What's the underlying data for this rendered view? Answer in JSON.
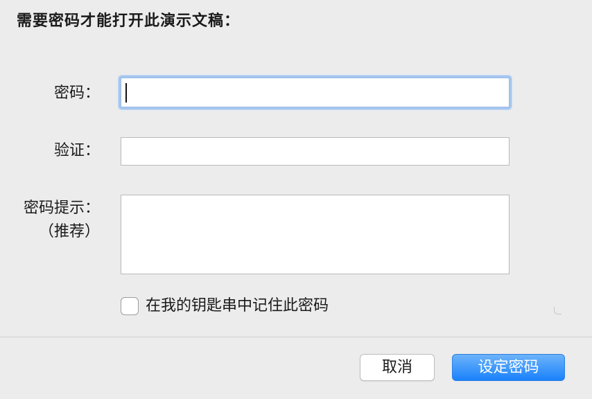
{
  "dialog": {
    "title": "需要密码才能打开此演示文稿："
  },
  "form": {
    "password_label": "密码：",
    "password_value": "",
    "verify_label": "验证：",
    "verify_value": "",
    "hint_label_line1": "密码提示：",
    "hint_label_line2": "（推荐）",
    "hint_value": "",
    "keychain_checkbox_label": "在我的钥匙串中记住此密码",
    "keychain_checked": false
  },
  "buttons": {
    "cancel_label": "取消",
    "set_password_label": "设定密码"
  },
  "colors": {
    "window_bg": "#ececec",
    "focus_ring": "#a5c6ef",
    "primary_button": "#1a82fb"
  }
}
